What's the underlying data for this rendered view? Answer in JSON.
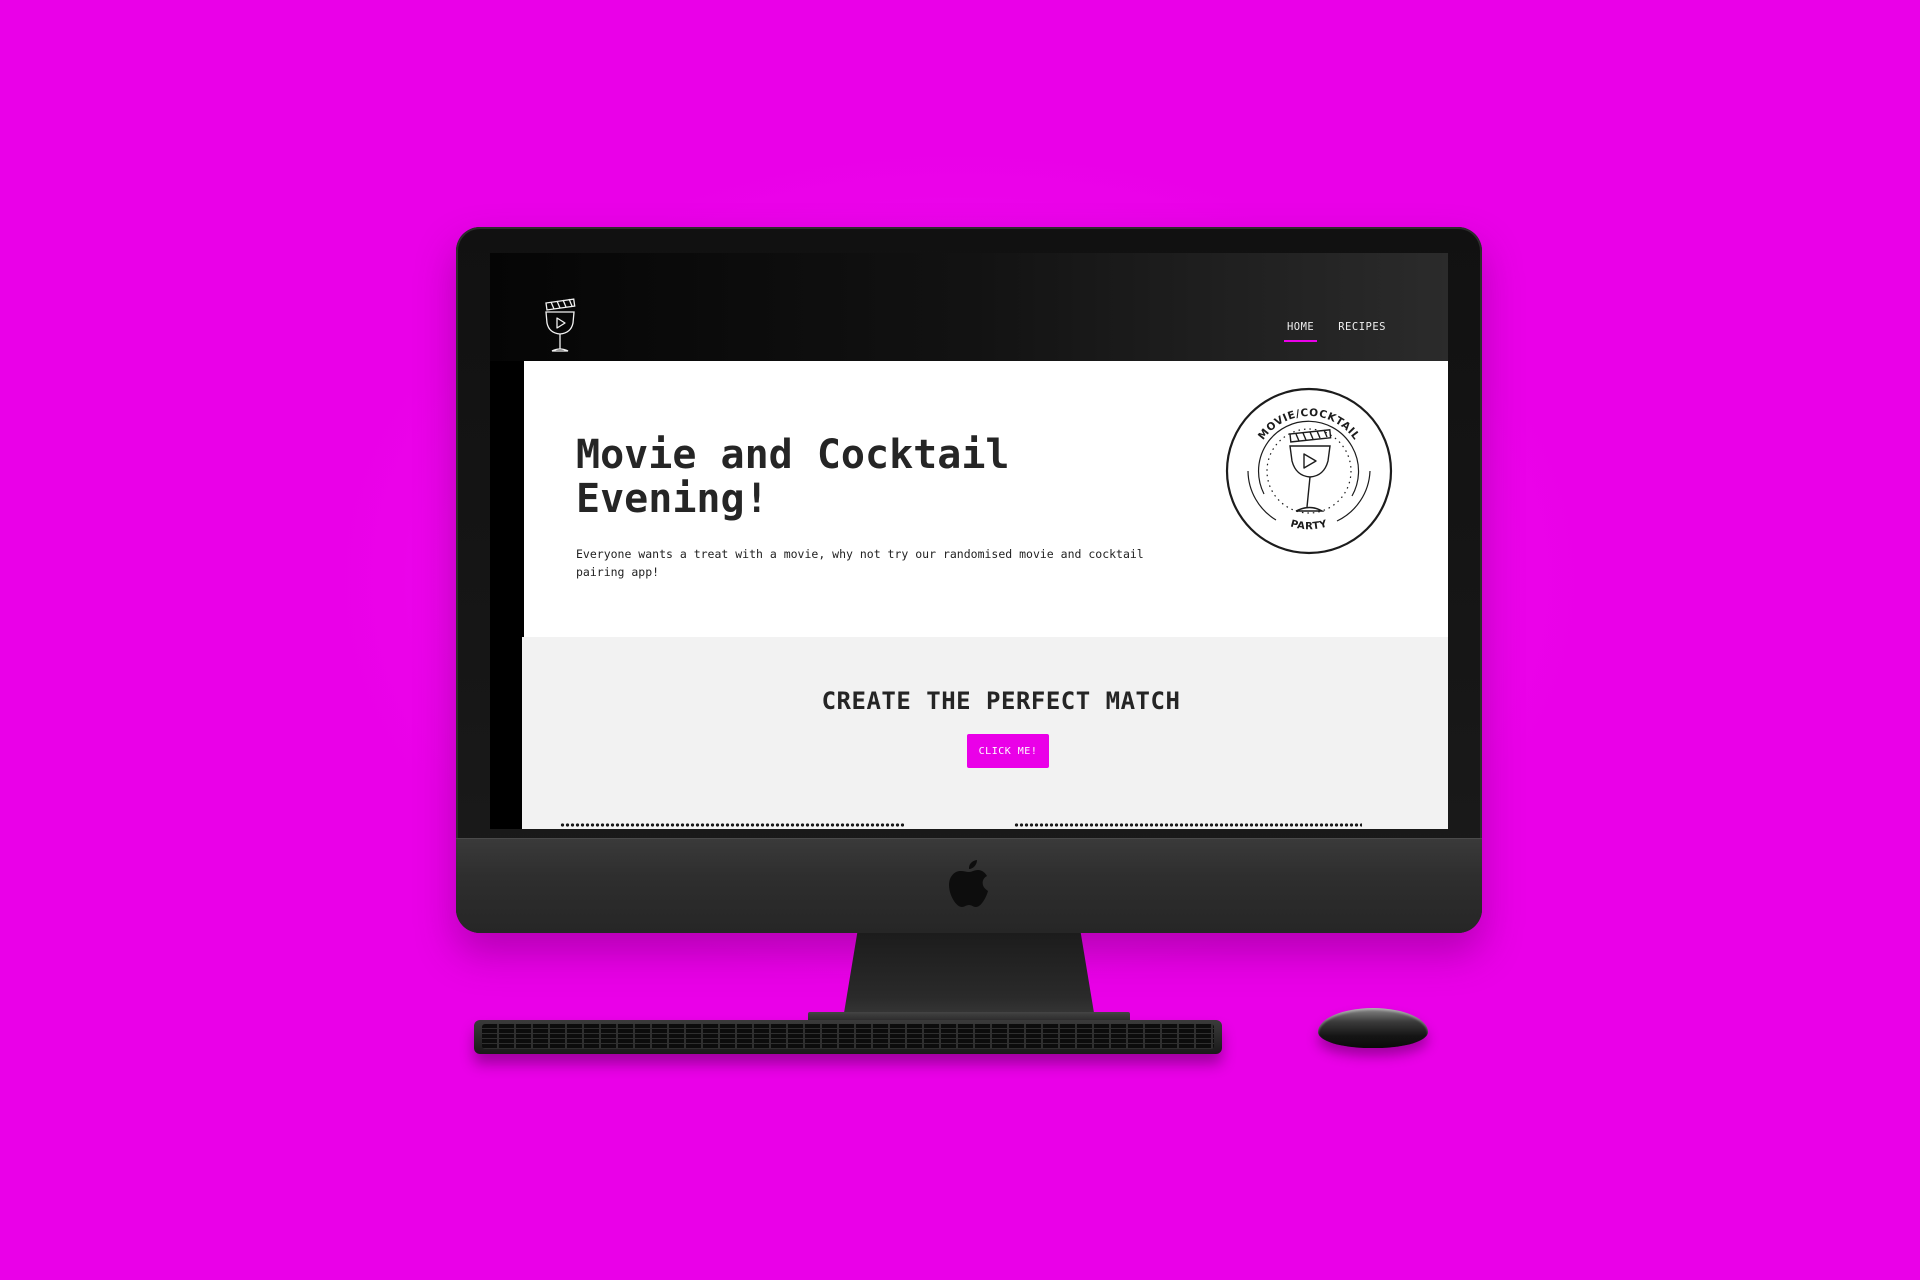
{
  "site": {
    "nav": [
      {
        "label": "HOME",
        "active": true
      },
      {
        "label": "RECIPES",
        "active": false
      }
    ],
    "logo_icon": "cocktail-clapperboard-icon"
  },
  "hero": {
    "title": "Movie and Cocktail Evening!",
    "description": "Everyone wants a treat with a movie, why not try our randomised movie and cocktail pairing app!",
    "badge": {
      "top_text": "MOVIE/COCKTAIL",
      "bottom_text": "PARTY",
      "icon": "cocktail-clapperboard-icon"
    }
  },
  "cta": {
    "title": "CREATE THE PERFECT MATCH",
    "button_label": "CLICK ME!"
  },
  "device": {
    "brand_icon": "apple-logo-icon"
  },
  "colors": {
    "background": "#ea00e8",
    "accent": "#ea00e8",
    "text": "#252525",
    "cta_band": "#f2f2f2",
    "header": "#111111"
  }
}
